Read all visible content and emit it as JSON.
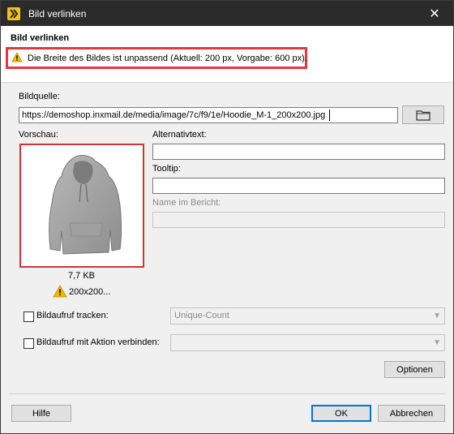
{
  "window": {
    "title": "Bild verlinken",
    "close_glyph": "✕"
  },
  "header": {
    "title": "Bild verlinken",
    "warning_text": "Die Breite des Bildes ist unpassend (Aktuell: 200 px, Vorgabe: 600 px).",
    "warning_icon": "warning-icon"
  },
  "form": {
    "source_label": "Bildquelle:",
    "source_value": "https://demoshop.inxmail.de/media/image/7c/f9/1e/Hoodie_M-1_200x200.jpg",
    "preview_label": "Vorschau:",
    "alt_label": "Alternativtext:",
    "alt_value": "",
    "tooltip_label": "Tooltip:",
    "tooltip_value": "",
    "report_name_label": "Name im Bericht:",
    "report_name_value": "",
    "image_size": "7,7 KB",
    "image_dims": "200x200...",
    "track_label": "Bildaufruf tracken:",
    "track_checked": false,
    "track_combo_value": "Unique-Count",
    "action_label": "Bildaufruf mit Aktion verbinden:",
    "action_checked": false,
    "action_combo_value": ""
  },
  "buttons": {
    "options": "Optionen",
    "help": "Hilfe",
    "ok": "OK",
    "cancel": "Abbrechen"
  },
  "colors": {
    "warning_border": "#e8373a",
    "preview_border": "#d0343a",
    "default_button": "#0078d7",
    "titlebar": "#2b2b2b"
  }
}
